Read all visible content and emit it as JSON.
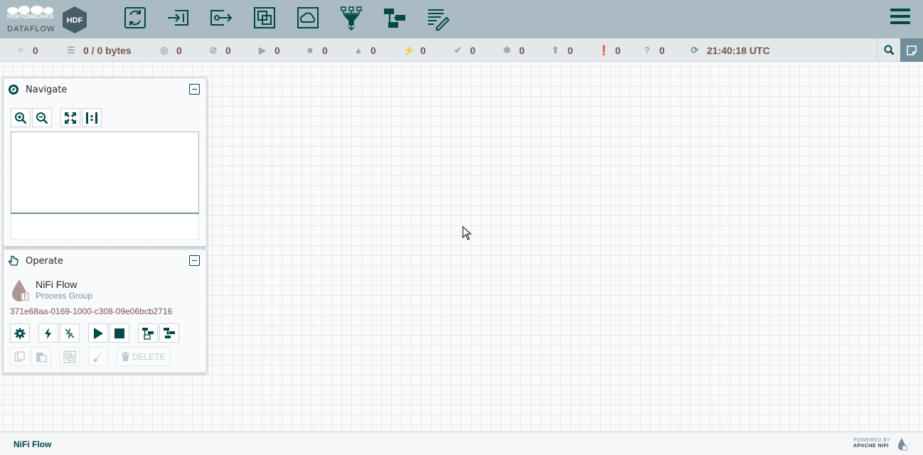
{
  "header": {
    "logo_brand": "HORTONWORKS",
    "logo_product": "DATAFLOW",
    "logo_badge": "HDF",
    "toolbar": [
      {
        "name": "processor",
        "icon": "processor-icon"
      },
      {
        "name": "input-port",
        "icon": "input-port-icon"
      },
      {
        "name": "output-port",
        "icon": "output-port-icon"
      },
      {
        "name": "process-group",
        "icon": "process-group-icon"
      },
      {
        "name": "remote-process-group",
        "icon": "remote-process-group-icon"
      },
      {
        "name": "funnel",
        "icon": "funnel-icon"
      },
      {
        "name": "template",
        "icon": "template-icon"
      },
      {
        "name": "label",
        "icon": "label-icon"
      }
    ],
    "menu_icon": "hamburger-menu-icon"
  },
  "status_bar": {
    "active_threads": "0",
    "queued": "0 / 0 bytes",
    "transmitting": "0",
    "not_transmitting": "0",
    "running": "0",
    "stopped": "0",
    "invalid": "0",
    "disabled": "0",
    "up_to_date": "0",
    "locally_modified": "0",
    "stale": "0",
    "sync_failure": "0",
    "unknown": "0",
    "last_refreshed": "21:40:18 UTC"
  },
  "navigate": {
    "title": "Navigate",
    "buttons": [
      "zoom-in",
      "zoom-out",
      "fit",
      "actual-size"
    ]
  },
  "operate": {
    "title": "Operate",
    "pg_name": "NiFi Flow",
    "pg_type": "Process Group",
    "pg_id": "371e68aa-0169-1000-c308-09e06bcb2716",
    "delete_label": "DELETE"
  },
  "footer": {
    "breadcrumb": "NiFi Flow",
    "powered_by_line1": "POWERED BY",
    "powered_by_line2": "APACHE NIFI"
  },
  "colors": {
    "header_bg": "#aabbc3",
    "accent": "#004849",
    "status_bg": "#e3e8eb",
    "status_text": "#775351"
  }
}
